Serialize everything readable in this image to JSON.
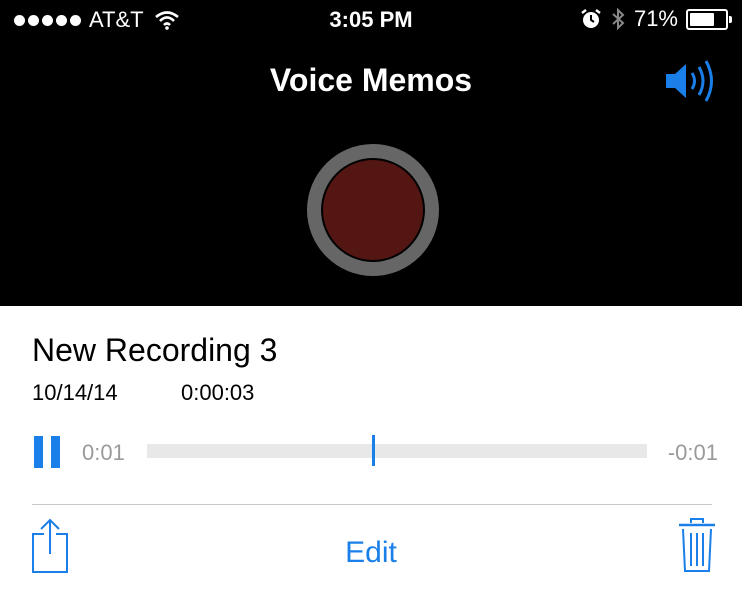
{
  "status_bar": {
    "carrier": "AT&T",
    "time": "3:05 PM",
    "battery_percent": "71%",
    "battery_level": 0.71,
    "signal_bars": 5,
    "icons": [
      "wifi-icon",
      "alarm-icon",
      "bluetooth-icon",
      "battery-icon"
    ]
  },
  "header": {
    "title": "Voice Memos",
    "speaker_icon": "speaker-icon"
  },
  "recorder": {
    "record_button_icon": "record-icon",
    "colors": {
      "record_fill": "#541612",
      "ring": "#666666"
    }
  },
  "recording": {
    "name": "New Recording 3",
    "date": "10/14/14",
    "duration": "0:00:03",
    "elapsed": "0:01",
    "remaining": "-0:01",
    "progress": 0.45,
    "pause_icon": "pause-icon"
  },
  "toolbar": {
    "share_icon": "share-icon",
    "edit_label": "Edit",
    "trash_icon": "trash-icon"
  },
  "accent_color": "#1a7fe8"
}
